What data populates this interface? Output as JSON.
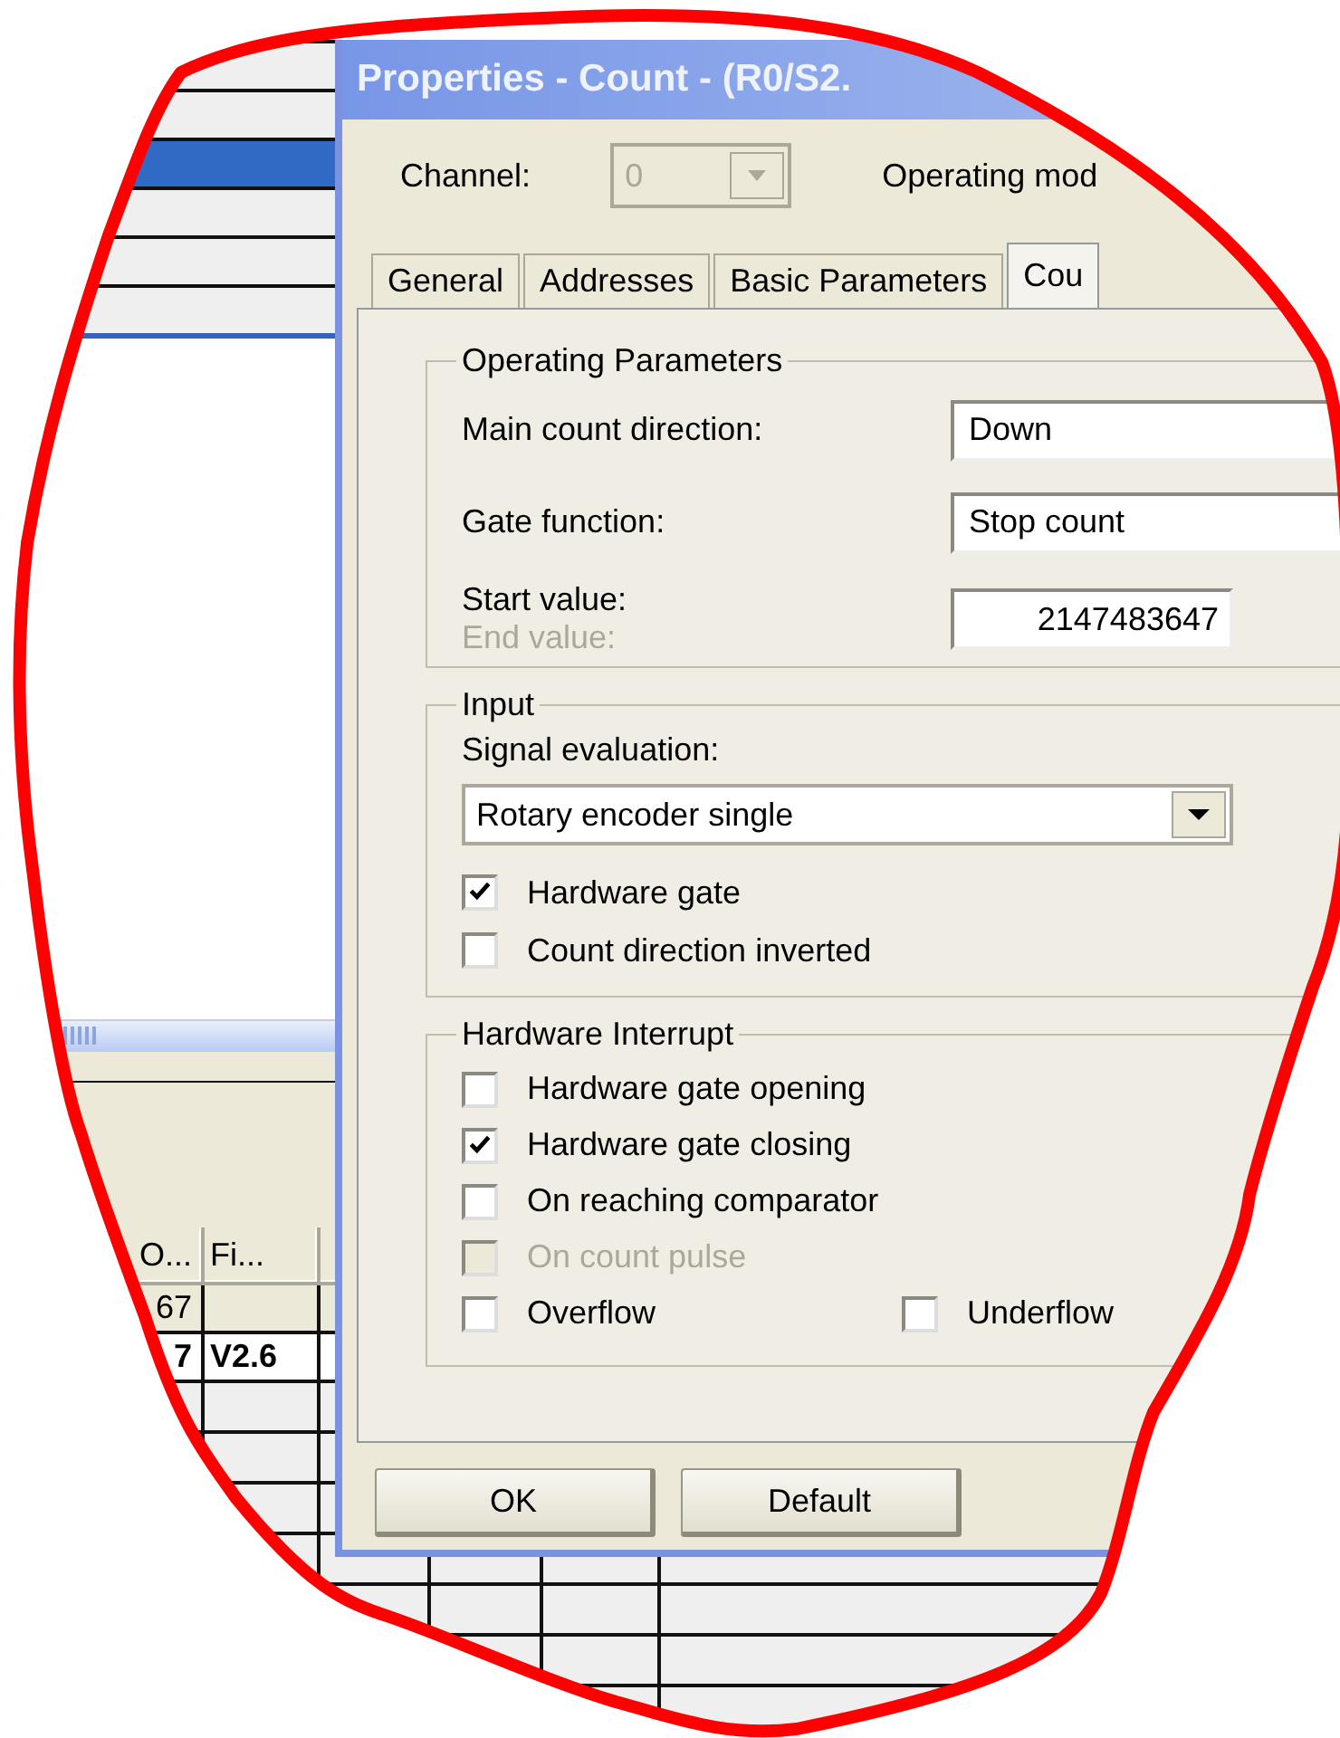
{
  "background_window": {
    "upper_list": {
      "rows": [
        {
          "selected": false
        },
        {
          "selected": false
        },
        {
          "selected": true
        },
        {
          "selected": false
        },
        {
          "selected": false
        },
        {
          "selected": false
        }
      ]
    },
    "table": {
      "columns": [
        "O...",
        "Fi..."
      ],
      "rows": [
        {
          "cells": [
            "67",
            ""
          ],
          "bold": false
        },
        {
          "cells": [
            "7",
            "V2.6"
          ],
          "bold": true
        }
      ]
    }
  },
  "dialog": {
    "title": "Properties - Count - (R0/S2.",
    "channel": {
      "label": "Channel:",
      "value": "0",
      "disabled": true
    },
    "operating_mode_label": "Operating mod",
    "tabs": [
      {
        "label": "General",
        "selected": false
      },
      {
        "label": "Addresses",
        "selected": false
      },
      {
        "label": "Basic Parameters",
        "selected": false
      },
      {
        "label": "Cou",
        "selected": true
      }
    ],
    "operating_parameters": {
      "title": "Operating Parameters",
      "fields": [
        {
          "label": "Main count direction:",
          "value": "Down"
        },
        {
          "label": "Gate function:",
          "value": "Stop count"
        }
      ],
      "start_value": {
        "label": "Start value:",
        "secondary_label": "End value:",
        "secondary_disabled": true,
        "value": "2147483647"
      }
    },
    "input": {
      "title": "Input",
      "signal_label": "Signal evaluation:",
      "signal_value": "Rotary encoder single",
      "checkboxes": [
        {
          "label": "Hardware gate",
          "checked": true,
          "disabled": false
        },
        {
          "label": "Count direction inverted",
          "checked": false,
          "disabled": false
        }
      ]
    },
    "hardware_interrupt": {
      "title": "Hardware Interrupt",
      "checkboxes": [
        {
          "label": "Hardware gate opening",
          "checked": false,
          "disabled": false
        },
        {
          "label": "Hardware gate closing",
          "checked": true,
          "disabled": false
        },
        {
          "label": "On reaching comparator",
          "checked": false,
          "disabled": false
        },
        {
          "label": "On count pulse",
          "checked": false,
          "disabled": true
        }
      ],
      "last_row": [
        {
          "label": "Overflow",
          "checked": false,
          "disabled": false
        },
        {
          "label": "Underflow",
          "checked": false,
          "disabled": false
        }
      ]
    },
    "buttons": [
      "OK",
      "Default"
    ]
  }
}
